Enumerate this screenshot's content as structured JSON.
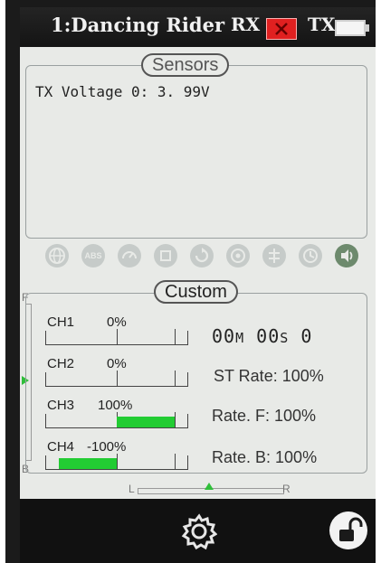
{
  "header": {
    "model_name": "1:Dancing Rider",
    "rx_label": "RX",
    "tx_label": "TX",
    "rx_status_color": "#e02020"
  },
  "sensors": {
    "title": "Sensors",
    "tx_voltage": "TX Voltage 0: 3. 99V"
  },
  "status_icons": [
    {
      "name": "globe-icon"
    },
    {
      "name": "abs-icon",
      "text": "ABS"
    },
    {
      "name": "speedometer-icon"
    },
    {
      "name": "gyro-icon"
    },
    {
      "name": "rotate-icon"
    },
    {
      "name": "wheel-icon"
    },
    {
      "name": "antenna-icon"
    },
    {
      "name": "clock-icon"
    },
    {
      "name": "sound-icon",
      "active": true
    }
  ],
  "custom": {
    "title": "Custom",
    "channels": [
      {
        "label": "CH1",
        "value": "0%",
        "fill": 0
      },
      {
        "label": "CH2",
        "value": "0%",
        "fill": 0
      },
      {
        "label": "CH3",
        "value": "100%",
        "fill": 1
      },
      {
        "label": "CH4",
        "value": "-100%",
        "fill": -1
      }
    ],
    "timer": {
      "minutes": "00",
      "m_unit": "M",
      "seconds": "00",
      "s_unit": "S",
      "tenths": "0"
    },
    "st_rate": "ST Rate: 100%",
    "rate_f": "Rate. F: 100%",
    "rate_b": "Rate. B: 100%"
  },
  "trims": {
    "vertical_top": "F",
    "vertical_bottom": "B",
    "horizontal_left": "L",
    "horizontal_right": "R"
  },
  "colors": {
    "bar_fill": "#22cc33",
    "trim_marker": "#2fbf3a"
  }
}
